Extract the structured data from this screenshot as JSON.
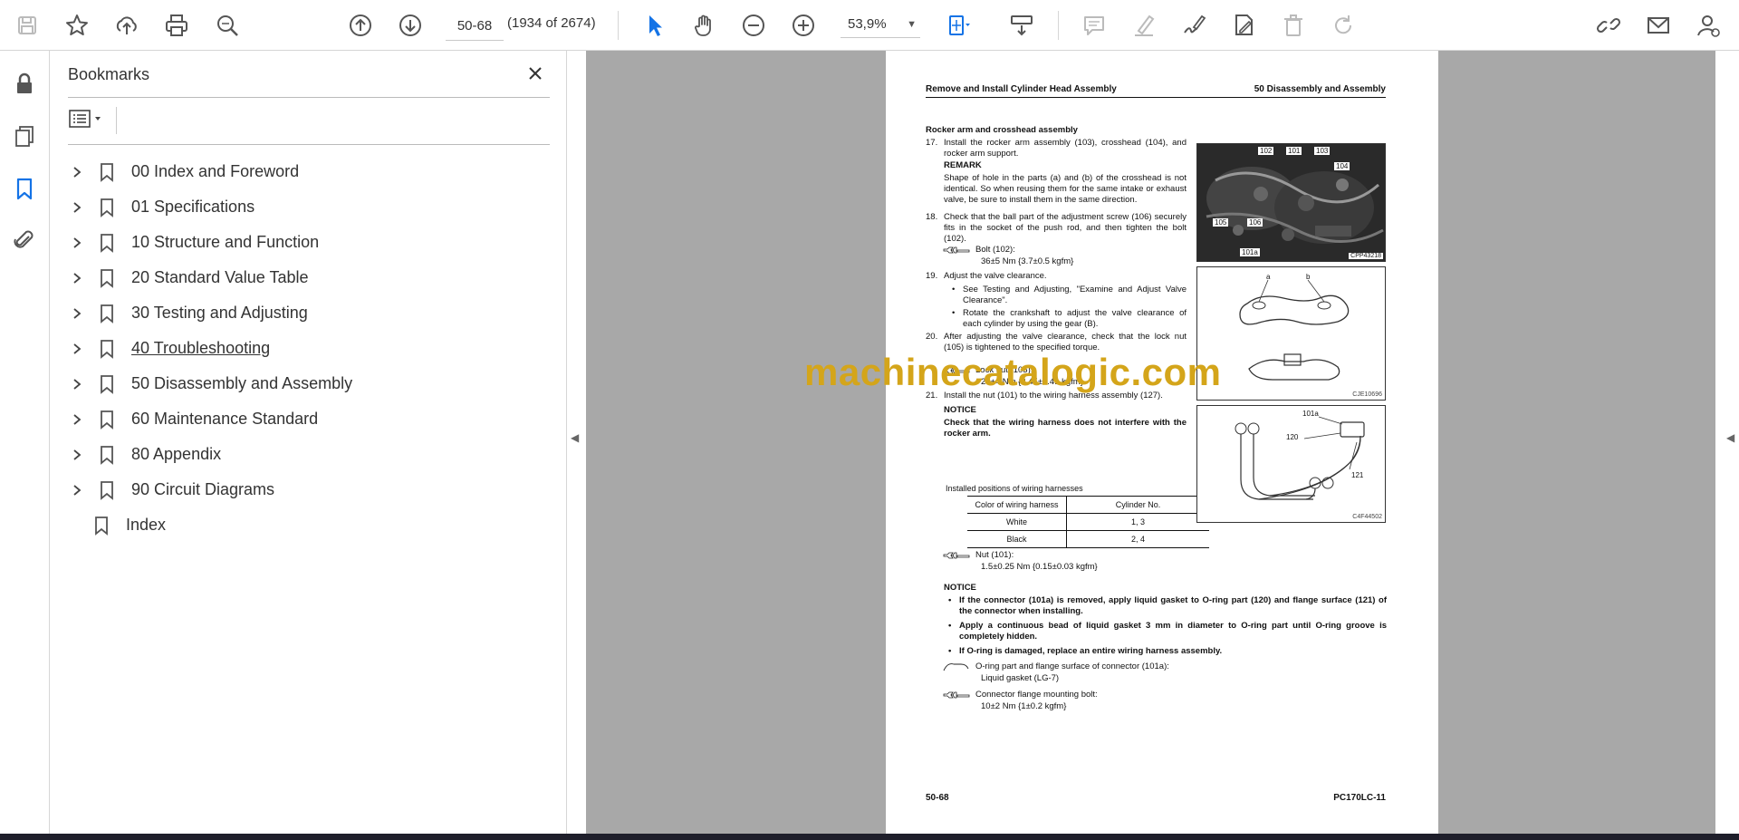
{
  "toolbar": {
    "page_value": "50-68",
    "page_count": "(1934 of 2674)",
    "zoom": "53,9%",
    "icons": [
      "save-icon",
      "bookmark-star-icon",
      "upload-icon",
      "print-icon",
      "find-icon",
      "prev-page-icon",
      "next-page-icon",
      "select-pointer-icon",
      "hand-icon",
      "zoom-out-icon",
      "zoom-in-icon",
      "fit-page-icon",
      "scroll-mode-icon",
      "comment-icon",
      "highlight-icon",
      "sign-icon",
      "edit-icon",
      "delete-icon",
      "redo-icon",
      "share-link-icon",
      "email-icon",
      "account-icon"
    ]
  },
  "bookmarks": {
    "title": "Bookmarks",
    "items": [
      {
        "label": "00 Index and Foreword",
        "expandable": true
      },
      {
        "label": "01 Specifications",
        "expandable": true
      },
      {
        "label": "10 Structure and Function",
        "expandable": true
      },
      {
        "label": "20 Standard Value Table",
        "expandable": true
      },
      {
        "label": "30 Testing and Adjusting",
        "expandable": true
      },
      {
        "label": "40 Troubleshooting",
        "expandable": true
      },
      {
        "label": "50 Disassembly and Assembly",
        "expandable": true
      },
      {
        "label": "60 Maintenance Standard",
        "expandable": true
      },
      {
        "label": "80 Appendix",
        "expandable": true
      },
      {
        "label": "90 Circuit Diagrams",
        "expandable": true
      },
      {
        "label": "Index",
        "expandable": false
      }
    ]
  },
  "document": {
    "header_left": "Remove and Install Cylinder Head Assembly",
    "header_right": "50 Disassembly and Assembly",
    "section_title": "Rocker arm and crosshead assembly",
    "step17_num": "17.",
    "step17": "Install the rocker arm assembly (103), crosshead (104), and rocker arm support.",
    "remark_label": "REMARK",
    "remark_text": "Shape of hole in the parts (a) and (b) of the crosshead is not identical. So when reusing them for the same intake or exhaust valve, be sure to install them in the same direction.",
    "step18_num": "18.",
    "step18": "Check that the ball part of the adjustment screw (106) securely fits in the socket of the push rod, and then tighten the bolt (102).",
    "bolt_label": "Bolt (102):",
    "bolt_value": "36±5 Nm {3.7±0.5 kgfm}",
    "step19_num": "19.",
    "step19": "Adjust the valve clearance.",
    "step19_b1": "See Testing and Adjusting, \"Examine and Adjust Valve Clearance\".",
    "step19_b2": "Rotate the crankshaft to adjust the valve clearance of each cylinder by using the gear (B).",
    "step20_num": "20.",
    "step20": "After adjusting the valve clearance, check that the lock nut (105) is tightened to the specified torque.",
    "locknut_label": "Lock nut (105):",
    "locknut_value": "24±4 Nm {2.45±0.41 kgfm}",
    "step21_num": "21.",
    "step21": "Install the nut (101) to the wiring harness assembly (127).",
    "notice1_label": "NOTICE",
    "notice1_text": "Check that the wiring harness does not interfere with the rocker arm.",
    "table_caption": "Installed positions of wiring harnesses",
    "table_headers": [
      "Color of wiring harness",
      "Cylinder No."
    ],
    "table_rows": [
      [
        "White",
        "1, 3"
      ],
      [
        "Black",
        "2, 4"
      ]
    ],
    "nut_label": "Nut (101):",
    "nut_value": "1.5±0.25 Nm {0.15±0.03 kgfm}",
    "notice2_label": "NOTICE",
    "notice2_b1": "If the connector (101a) is removed, apply liquid gasket to O-ring part (120) and flange surface (121) of the connector when installing.",
    "notice2_b2": "Apply a continuous bead of liquid gasket 3 mm in diameter to O-ring part until O-ring groove is completely hidden.",
    "notice2_b3": "If O-ring is damaged, replace an entire wiring harness assembly.",
    "gasket_label": "O-ring part and flange surface of connector (101a):",
    "gasket_value": "Liquid gasket (LG-7)",
    "flange_label": "Connector flange mounting bolt:",
    "flange_value": "10±2 Nm {1±0.2 kgfm}",
    "footer_left": "50-68",
    "footer_right": "PC170LC-11",
    "fig1_labels": [
      "102",
      "101",
      "103",
      "104",
      "105",
      "106",
      "101a"
    ],
    "fig1_caption": "CPP43218",
    "fig2_labels": [
      "a",
      "b"
    ],
    "fig2_caption": "CJE10696",
    "fig3_labels": [
      "101a",
      "120",
      "121"
    ],
    "fig3_caption": "C4F44502",
    "watermark": "machinecatalogic.com"
  }
}
